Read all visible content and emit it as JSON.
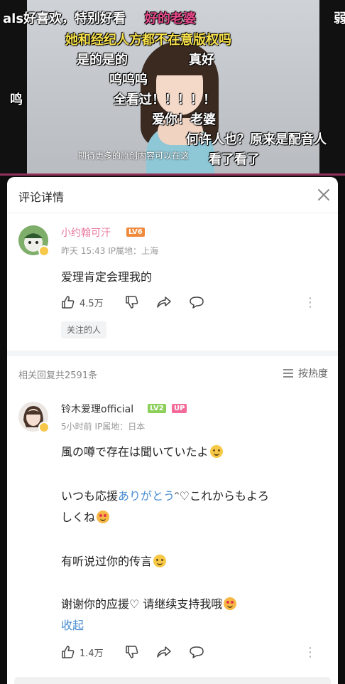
{
  "video": {
    "danmaku": [
      {
        "text": "als好喜欢，特别好看",
        "style": "white"
      },
      {
        "text": "好的老婆",
        "style": "pink"
      },
      {
        "text": "她和经纪人方都不在意版权吗",
        "style": "yellow"
      },
      {
        "text": "是的是的",
        "style": "white"
      },
      {
        "text": "真好",
        "style": "white"
      },
      {
        "text": "呜呜呜",
        "style": "white"
      },
      {
        "text": "鸣",
        "style": "white"
      },
      {
        "text": "全看过！！！！！",
        "style": "white"
      },
      {
        "text": "爱你！老婆",
        "style": "white"
      },
      {
        "text": "何许人也？原来是配音人",
        "style": "white"
      },
      {
        "text": "看了看了",
        "style": "white"
      },
      {
        "text": "弱",
        "style": "white"
      }
    ],
    "caption": "期待更多的原创内容可以在这"
  },
  "panel": {
    "title": "评论详情"
  },
  "main_comment": {
    "username": "小约翰可汗",
    "level": "LV6",
    "meta": "昨天 15:43 IP属地：上海",
    "text": "爱理肯定会理我的",
    "likes": "4.5万",
    "chip": "关注的人"
  },
  "replies_bar": {
    "count": "相关回复共2591条",
    "sort": "按热度"
  },
  "reply": {
    "username": "铃木爱理official",
    "level": "LV2",
    "badge": "UP",
    "meta": "5小时前 IP属地：日本",
    "line1": "風の噂で存在は聞いていたよ",
    "line2_prefix": "いつも応援",
    "line2_link": "ありがとう",
    "line2_suffix": "ᵔ♡これからもよろ",
    "line3": "しくね",
    "line4": "有听说过你的传言",
    "line5": "谢谢你的应援♡ 请继续支持我哦",
    "collapse": "收起",
    "likes": "1.4万"
  }
}
